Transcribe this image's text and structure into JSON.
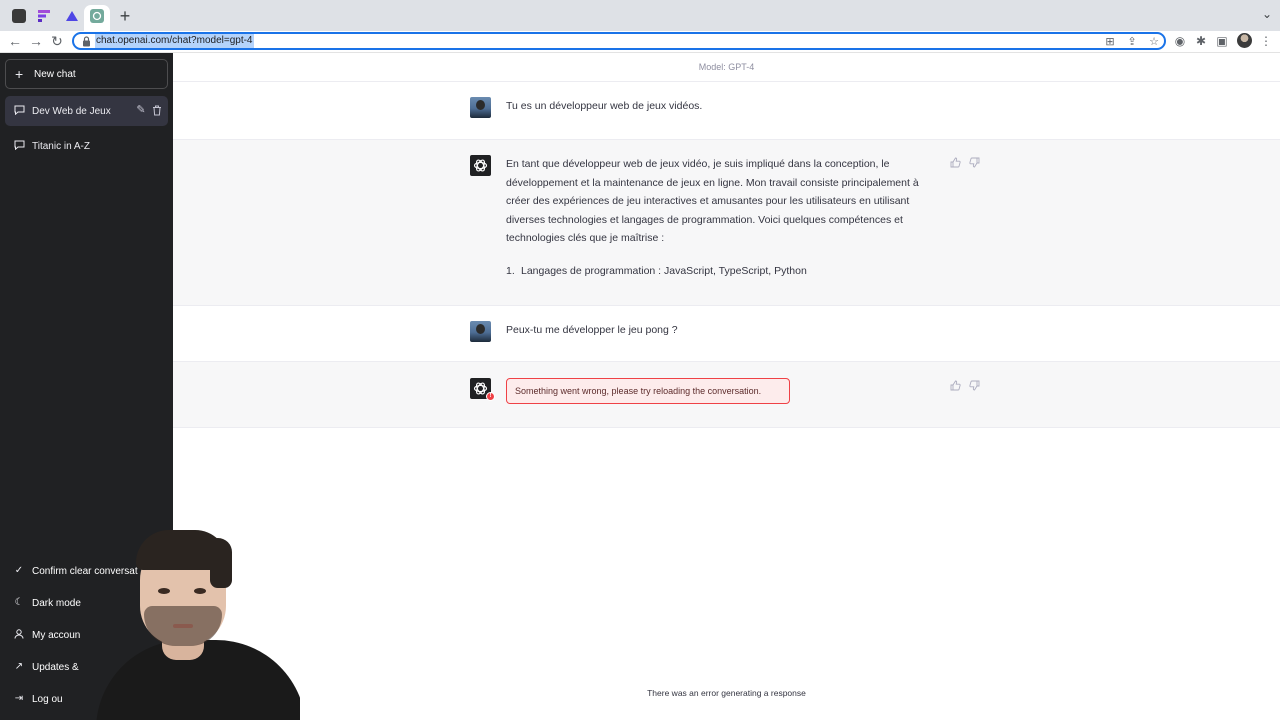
{
  "browser": {
    "url": "chat.openai.com/chat?model=gpt-4",
    "new_tab_label": "+",
    "tab_menu_label": "⌄"
  },
  "sidebar": {
    "new_chat": "New chat",
    "conversations": [
      {
        "label": "Dev Web de Jeux",
        "active": true
      },
      {
        "label": "Titanic in A-Z",
        "active": false
      }
    ],
    "bottom": [
      {
        "label": "Confirm clear conversat",
        "icon": "check-icon"
      },
      {
        "label": "Dark mode",
        "icon": "moon-icon"
      },
      {
        "label": "My accoun",
        "icon": "user-icon"
      },
      {
        "label": "Updates &",
        "icon": "external-link-icon"
      },
      {
        "label": "Log ou",
        "icon": "logout-icon"
      }
    ]
  },
  "main": {
    "model_label": "Model: GPT-4",
    "messages": [
      {
        "role": "user",
        "text": "Tu es un développeur web de jeux vidéos."
      },
      {
        "role": "assistant",
        "text": "En tant que développeur web de jeux vidéo, je suis impliqué dans la conception, le développement et la maintenance de jeux en ligne. Mon travail consiste principalement à créer des expériences de jeu interactives et amusantes pour les utilisateurs en utilisant diverses technologies et langages de programmation. Voici quelques compétences et technologies clés que je maîtrise :",
        "list": [
          {
            "num": "1.",
            "text": "Langages de programmation : JavaScript, TypeScript, Python"
          }
        ]
      },
      {
        "role": "user",
        "text": "Peux-tu me développer le jeu pong ?"
      },
      {
        "role": "assistant",
        "error": "Something went wrong, please try reloading the conversation."
      }
    ],
    "footer_error": "There was an error generating a response"
  },
  "colors": {
    "sidebar_bg": "#202123",
    "assistant_bg": "#f7f7f8",
    "error_red": "#ef4146",
    "url_selection": "#b4d3fb",
    "focus_blue": "#1a73e8"
  }
}
